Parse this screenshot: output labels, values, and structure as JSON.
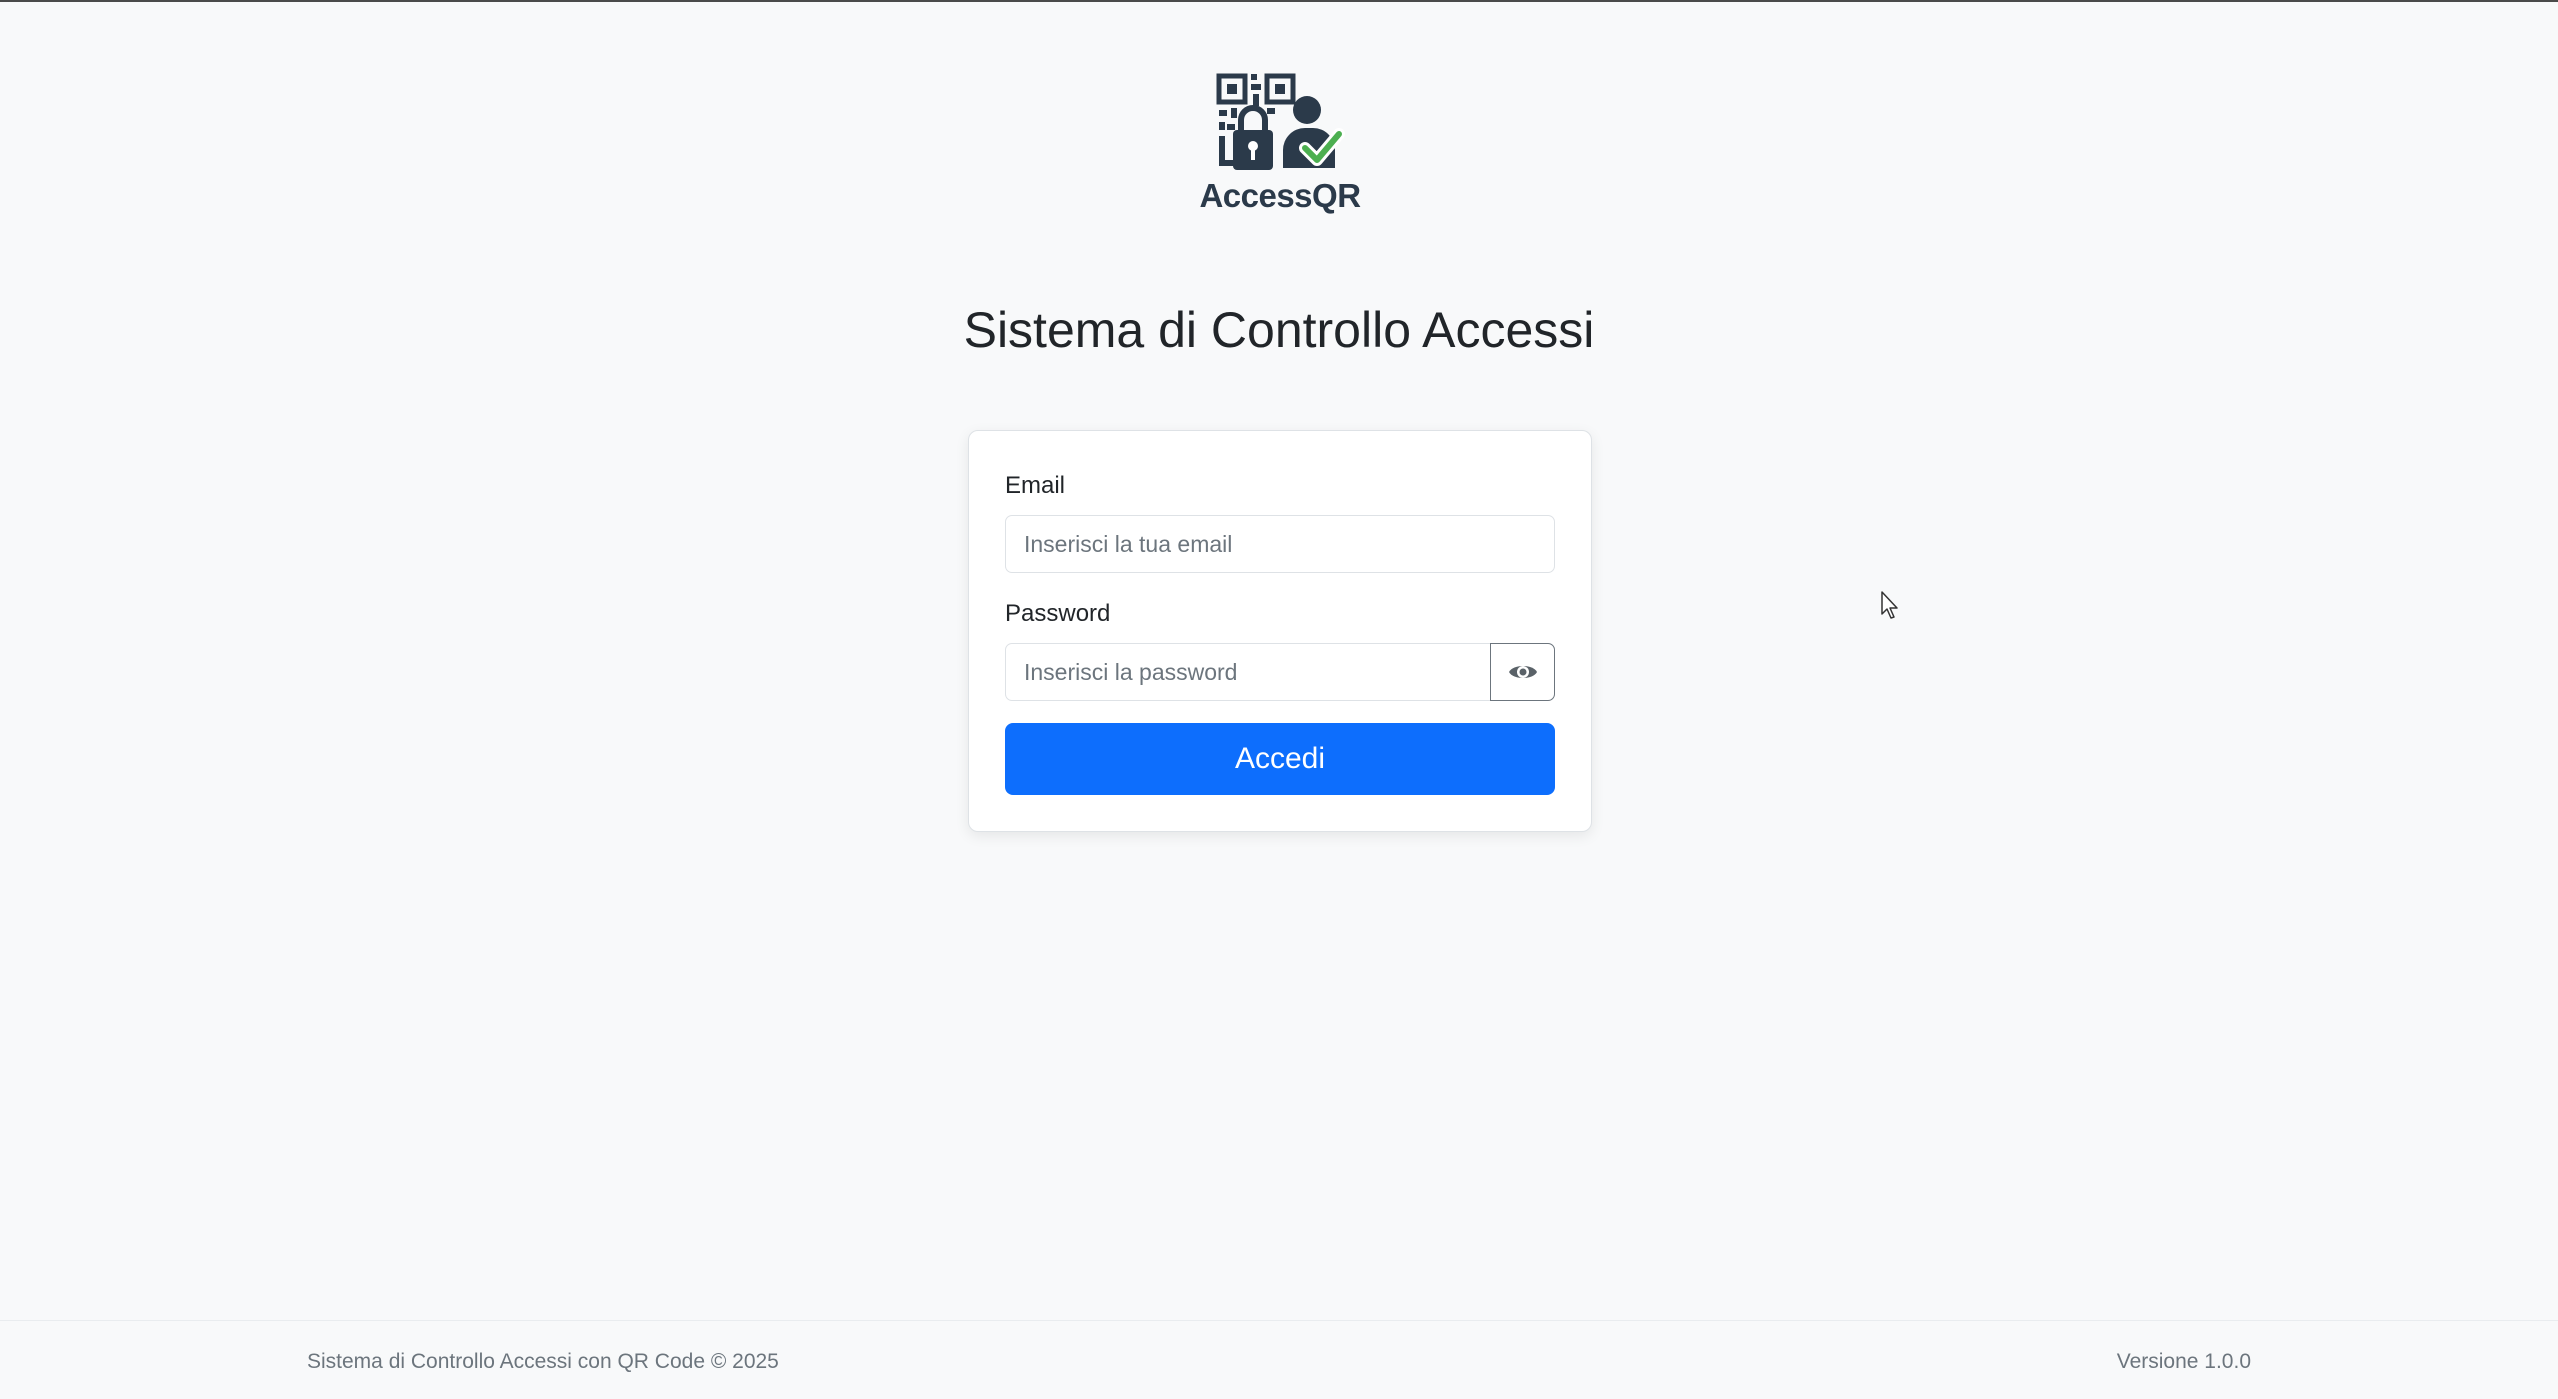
{
  "brand": {
    "logo_icon": "qr-lock-user-check-logo",
    "name": "AccessQR",
    "colors": {
      "dark": "#2b3a4a",
      "check": "#4caf50"
    }
  },
  "page": {
    "title": "Sistema di Controllo Accessi"
  },
  "login_form": {
    "email_label": "Email",
    "email_placeholder": "Inserisci la tua email",
    "email_value": "",
    "password_label": "Password",
    "password_placeholder": "Inserisci la password",
    "password_value": "",
    "toggle_icon": "eye-icon",
    "submit_label": "Accedi"
  },
  "footer": {
    "left_text": "Sistema di Controllo Accessi con QR Code © 2025",
    "right_text": "Versione 1.0.0"
  },
  "colors": {
    "primary": "#0d6efd",
    "background": "#f8f9fa",
    "text": "#212529",
    "muted": "#6c757d"
  }
}
